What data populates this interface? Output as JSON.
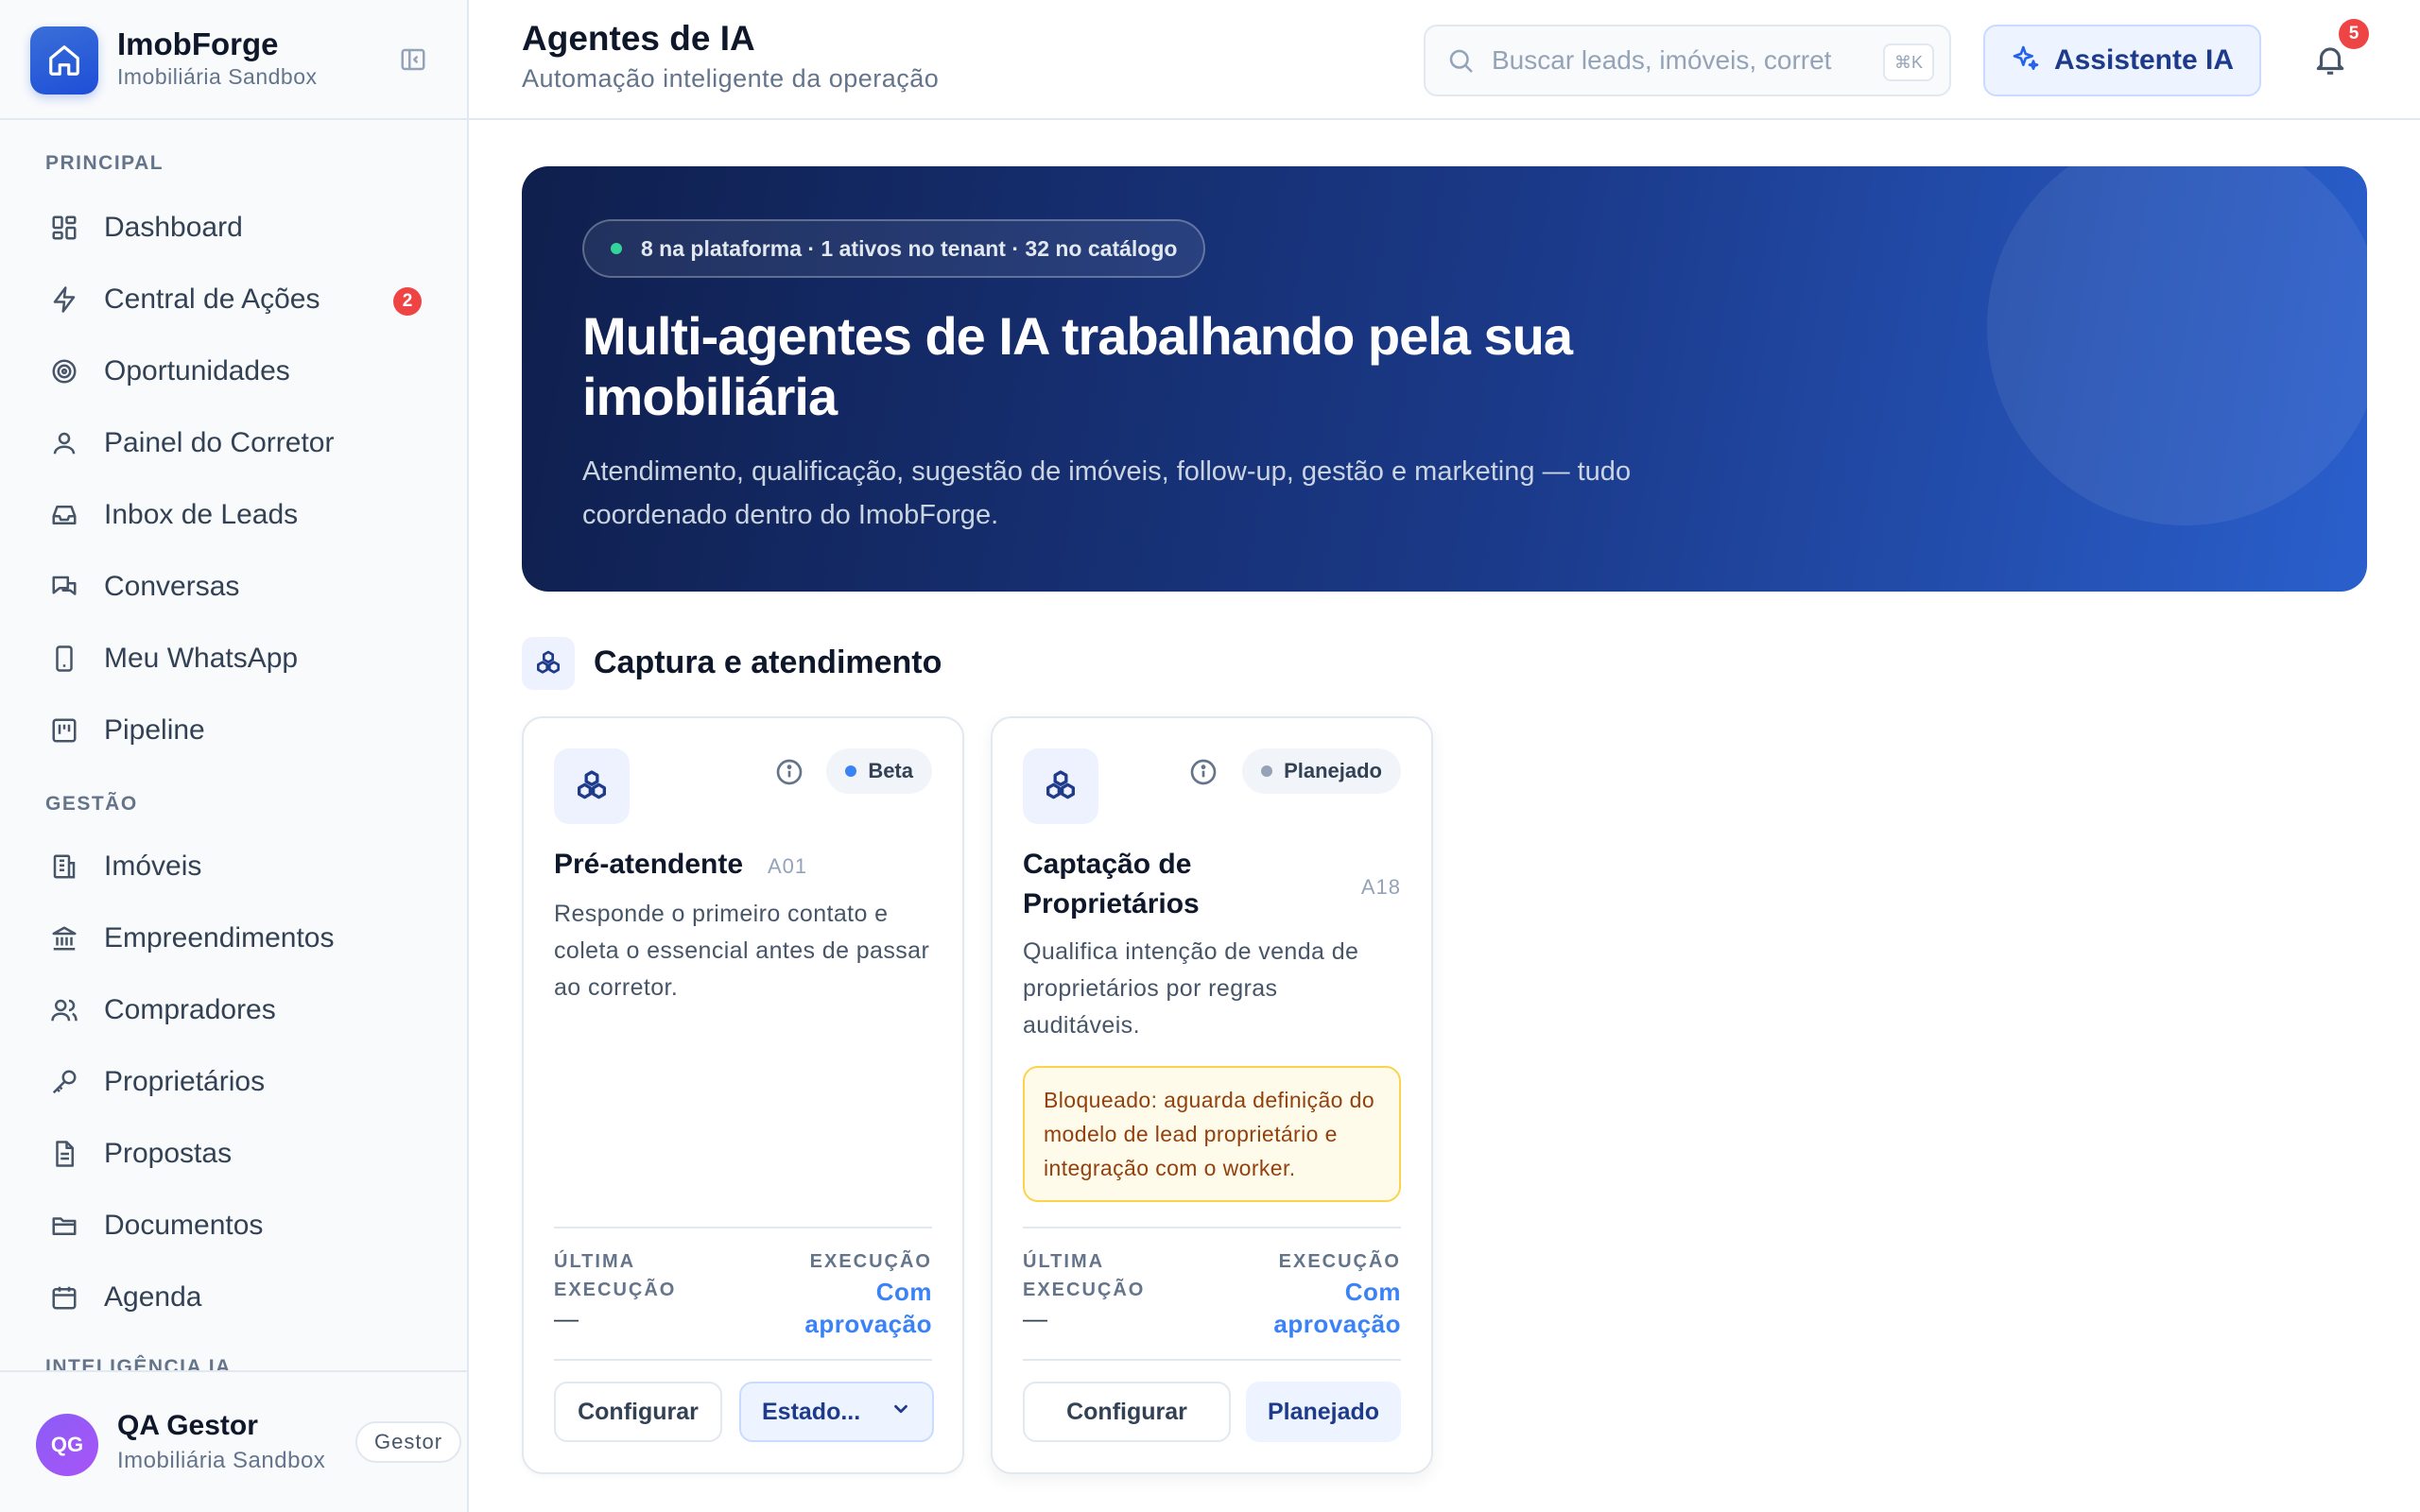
{
  "brand": {
    "name": "ImobForge",
    "tenant": "Imobiliária Sandbox"
  },
  "nav": {
    "principal_label": "PRINCIPAL",
    "gestao_label": "GESTÃO",
    "ia_label": "INTELIGÊNCIA IA",
    "principal": [
      {
        "label": "Dashboard",
        "icon": "dashboard-icon"
      },
      {
        "label": "Central de Ações",
        "icon": "bolt-icon",
        "badge": "2"
      },
      {
        "label": "Oportunidades",
        "icon": "target-icon"
      },
      {
        "label": "Painel do Corretor",
        "icon": "user-icon"
      },
      {
        "label": "Inbox de Leads",
        "icon": "inbox-icon"
      },
      {
        "label": "Conversas",
        "icon": "chat-icon"
      },
      {
        "label": "Meu WhatsApp",
        "icon": "phone-icon"
      },
      {
        "label": "Pipeline",
        "icon": "kanban-icon"
      }
    ],
    "gestao": [
      {
        "label": "Imóveis",
        "icon": "building-icon"
      },
      {
        "label": "Empreendimentos",
        "icon": "landmark-icon"
      },
      {
        "label": "Compradores",
        "icon": "users-icon"
      },
      {
        "label": "Proprietários",
        "icon": "key-icon"
      },
      {
        "label": "Propostas",
        "icon": "document-icon"
      },
      {
        "label": "Documentos",
        "icon": "folder-icon"
      },
      {
        "label": "Agenda",
        "icon": "calendar-icon"
      }
    ]
  },
  "user": {
    "initials": "QG",
    "name": "QA Gestor",
    "tenant": "Imobiliária Sandbox",
    "role": "Gestor"
  },
  "header": {
    "title": "Agentes de IA",
    "subtitle": "Automação inteligente da operação",
    "search_placeholder": "Buscar leads, imóveis, corretores...",
    "search_shortcut": "⌘K",
    "assistant_label": "Assistente IA",
    "notifications_count": "5"
  },
  "hero": {
    "stats": "8 na plataforma · 1 ativos no tenant · 32 no catálogo",
    "title": "Multi-agentes de IA trabalhando pela sua imobiliária",
    "description": "Atendimento, qualificação, sugestão de imóveis, follow-up, gestão e marketing — tudo coordenado dentro do ImobForge."
  },
  "section": {
    "title": "Captura e atendimento"
  },
  "cards": [
    {
      "name": "Pré-atendente",
      "code": "A01",
      "status": "Beta",
      "status_color": "#3b82f6",
      "description": "Responde o primeiro contato e coleta o essencial antes de passar ao corretor.",
      "last_run_label": "ÚLTIMA EXECUÇÃO",
      "last_run_value": "—",
      "execution_label": "EXECUÇÃO",
      "execution_value": "Com aprovação",
      "config_label": "Configurar",
      "state_select": "Estado..."
    },
    {
      "name": "Captação de Proprietários",
      "code": "A18",
      "status": "Planejado",
      "status_color": "#94a3b8",
      "description": "Qualifica intenção de venda de proprietários por regras auditáveis.",
      "warning": "Bloqueado: aguarda definição do modelo de lead proprietário e integração com o worker.",
      "last_run_label": "ÚLTIMA EXECUÇÃO",
      "last_run_value": "—",
      "execution_label": "EXECUÇÃO",
      "execution_value": "Com aprovação",
      "config_label": "Configurar",
      "planned_label": "Planejado"
    }
  ]
}
